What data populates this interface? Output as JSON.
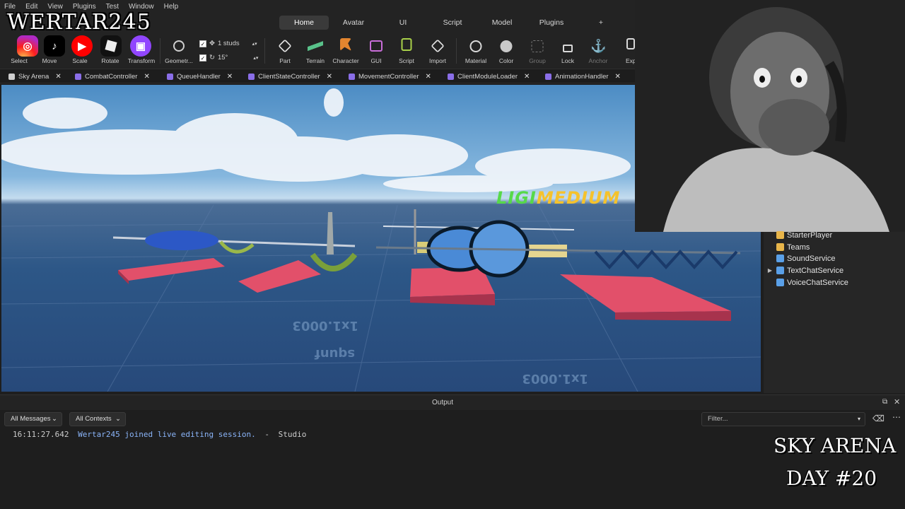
{
  "watermark": "WERTAR245",
  "menu": [
    "File",
    "Edit",
    "View",
    "Plugins",
    "Test",
    "Window",
    "Help"
  ],
  "ribbon_tabs": [
    {
      "label": "Home",
      "active": true
    },
    {
      "label": "Avatar"
    },
    {
      "label": "UI"
    },
    {
      "label": "Script"
    },
    {
      "label": "Model"
    },
    {
      "label": "Plugins"
    },
    {
      "label": "+"
    }
  ],
  "tools": {
    "select": "Select",
    "move": "Move",
    "scale": "Scale",
    "rotate": "Rotate",
    "transform": "Transform",
    "geometry": "Geometr...",
    "part": "Part",
    "terrain": "Terrain",
    "character": "Character",
    "gui": "GUI",
    "script": "Script",
    "import": "Import",
    "material": "Material",
    "color": "Color",
    "group": "Group",
    "lock": "Lock",
    "anchor": "Anchor",
    "exp": "Exp"
  },
  "snap": {
    "move_value": "1 studs",
    "rotate_value": "15°"
  },
  "file_tabs": [
    "Sky Arena",
    "CombatController",
    "QueueHandler",
    "ClientStateController",
    "MovementController",
    "ClientModuleLoader",
    "AnimationHandler"
  ],
  "viewport": {
    "hud_text": {
      "left": "LIGI",
      "right": "MEDIUM"
    },
    "grid_labels": [
      "squnf",
      "1x1.0003"
    ]
  },
  "explorer": {
    "items": [
      {
        "label": "StarterPlayer",
        "color": "#e8b54a",
        "expandable": false
      },
      {
        "label": "Teams",
        "color": "#e8b54a",
        "expandable": false
      },
      {
        "label": "SoundService",
        "color": "#5aa0e8",
        "expandable": false
      },
      {
        "label": "TextChatService",
        "color": "#5aa0e8",
        "expandable": true
      },
      {
        "label": "VoiceChatService",
        "color": "#5aa0e8",
        "expandable": false
      }
    ]
  },
  "output": {
    "title": "Output",
    "messages_filter": "All Messages",
    "contexts_filter": "All Contexts",
    "search_placeholder": "Filter...",
    "log": [
      {
        "time": "16:11:27.642",
        "message": "Wertar245 joined live editing session.",
        "separator": "-",
        "source": "Studio"
      }
    ]
  },
  "overlay": {
    "line1": "SKY ARENA",
    "line2": "DAY #20"
  }
}
